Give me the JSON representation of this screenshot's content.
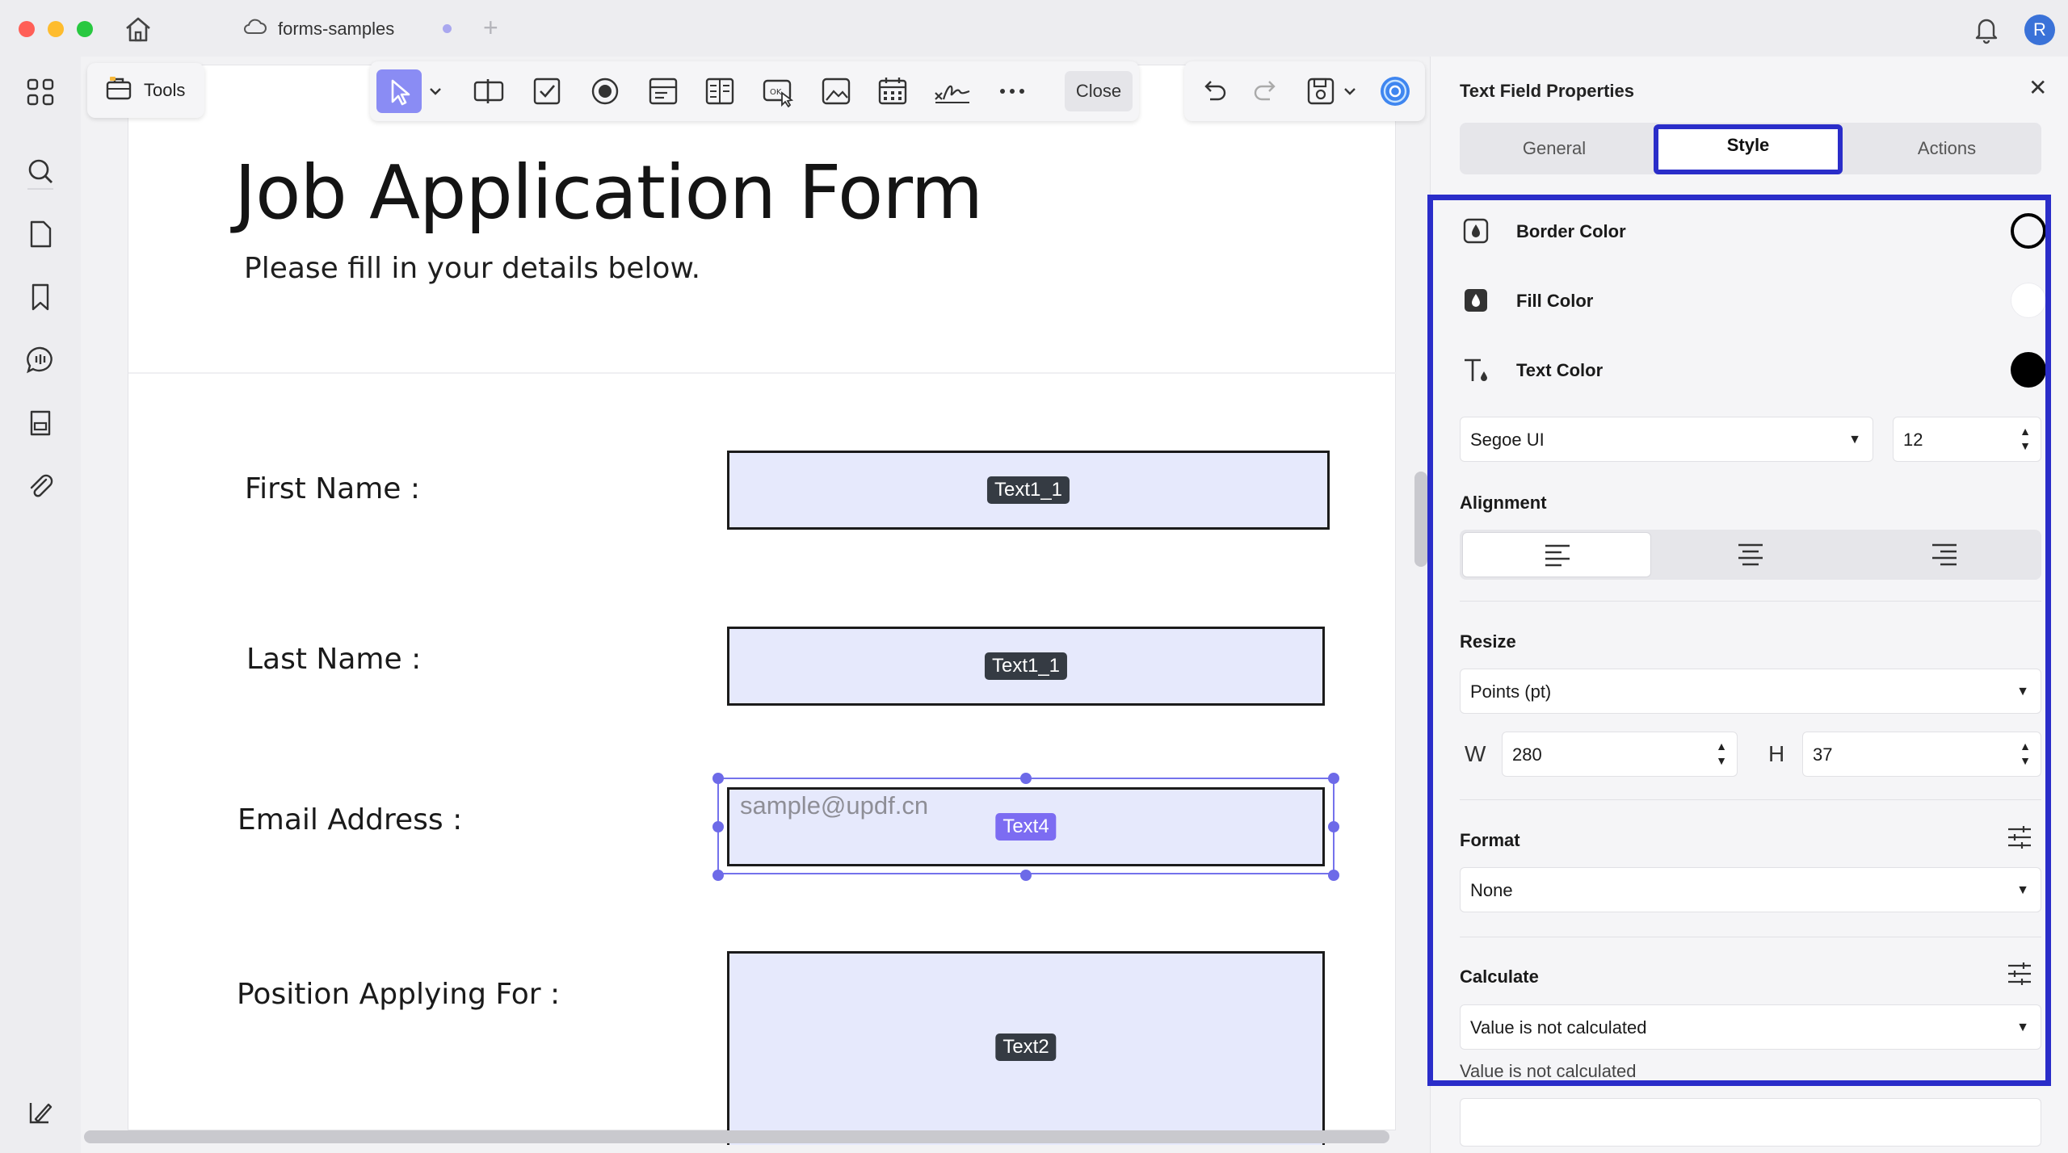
{
  "window": {
    "tab_title": "forms-samples",
    "add_tab": "+",
    "avatar_initial": "R"
  },
  "sidebar": {
    "icons": [
      "grid-icon",
      "search-icon",
      "pages-icon",
      "bookmark-icon",
      "comment-icon",
      "stamp-icon",
      "attachment-icon",
      "layers-icon"
    ]
  },
  "toolbar": {
    "tools_label": "Tools",
    "close_label": "Close",
    "icons": [
      "select-icon",
      "text-field-icon",
      "checkbox-icon",
      "radio-icon",
      "combo-box-icon",
      "list-box-icon",
      "button-icon",
      "image-icon",
      "date-icon",
      "signature-icon",
      "more-icon"
    ],
    "right_icons": [
      "undo-icon",
      "redo-icon",
      "save-icon",
      "ai-assistant-icon"
    ]
  },
  "document": {
    "title": "Job Application Form",
    "subtitle": "Please fill in your details below.",
    "fields": [
      {
        "label": "First Name :",
        "tag": "Text1_1",
        "placeholder": ""
      },
      {
        "label": "Last Name :",
        "tag": "Text1_1",
        "placeholder": ""
      },
      {
        "label": "Email Address :",
        "tag": "Text4",
        "placeholder": "sample@updf.cn",
        "selected": true
      },
      {
        "label": "Position Applying For :",
        "tag": "Text2",
        "placeholder": ""
      }
    ]
  },
  "panel": {
    "title": "Text Field Properties",
    "tabs": [
      "General",
      "Style",
      "Actions"
    ],
    "active_tab": "Style",
    "border_color_label": "Border Color",
    "fill_color_label": "Fill Color",
    "text_color_label": "Text Color",
    "colors": {
      "border": "#000000",
      "fill": "#ffffff",
      "text": "#000000"
    },
    "font_family": "Segoe UI",
    "font_size": "12",
    "alignment_label": "Alignment",
    "alignment_selected": "left",
    "resize_label": "Resize",
    "resize_unit": "Points (pt)",
    "width_label": "W",
    "width_value": "280",
    "height_label": "H",
    "height_value": "37",
    "format_label": "Format",
    "format_value": "None",
    "calculate_label": "Calculate",
    "calculate_value": "Value is not calculated",
    "calculate_note": "Value is not calculated"
  },
  "colors": {
    "accent": "#2a2dc9",
    "selection": "#7472ec",
    "field_fill": "#e6e9fc"
  }
}
